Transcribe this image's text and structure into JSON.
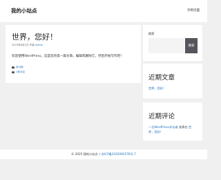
{
  "header": {
    "site_title": "我的小站点",
    "nav_label": "示例页面"
  },
  "post": {
    "title": "世界，您好！",
    "meta_date": "2023年8月1日",
    "meta_author_prefix": "作者",
    "meta_author": "admin",
    "content": "欢迎使用WordPress。这是您的第一篇文章。编辑或删除它，然后开始写作吧！",
    "category": "未分类",
    "comment_link": "1条评论"
  },
  "sidebar": {
    "search": {
      "label": "搜索",
      "button": "搜索",
      "value": ""
    },
    "recent_posts": {
      "title": "近期文章",
      "items": [
        "世界，您好！"
      ]
    },
    "recent_comments": {
      "title": "近期评论",
      "commenter": "一位WordPress评论者",
      "connector": "发表在",
      "post_link_part1": "世",
      "post_link_part2": "界，您好！"
    }
  },
  "footer": {
    "copyright": "© 2025 我的小站点 • ",
    "icp_link": "苏ICP备2020092578号-7"
  }
}
